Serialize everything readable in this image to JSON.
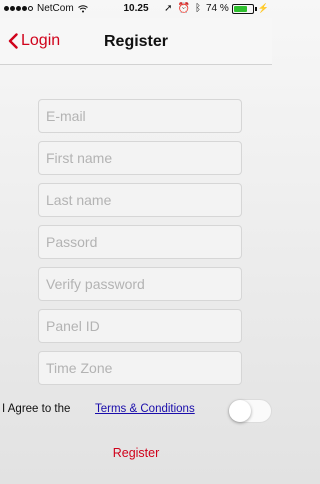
{
  "status_bar": {
    "carrier": "NetCom",
    "time": "10.25",
    "battery_text": "74 %",
    "battery_level": 0.74,
    "icons": [
      "signal-dots-icon",
      "wifi-icon",
      "location-arrow-icon",
      "alarm-icon",
      "bluetooth-icon",
      "battery-icon",
      "charging-bolt-icon"
    ]
  },
  "nav": {
    "back_label": "Login",
    "title": "Register",
    "accent_color": "#d0021b"
  },
  "form": {
    "email_placeholder": "E-mail",
    "first_name_placeholder": "First name",
    "last_name_placeholder": "Last name",
    "password_placeholder": "Passord",
    "verify_password_placeholder": "Verify password",
    "panel_id_placeholder": "Panel ID",
    "time_zone_placeholder": "Time Zone"
  },
  "terms": {
    "prefix": "I Agree to the",
    "link_label": "Terms & Conditions",
    "toggle_on": false
  },
  "register_label": "Register"
}
